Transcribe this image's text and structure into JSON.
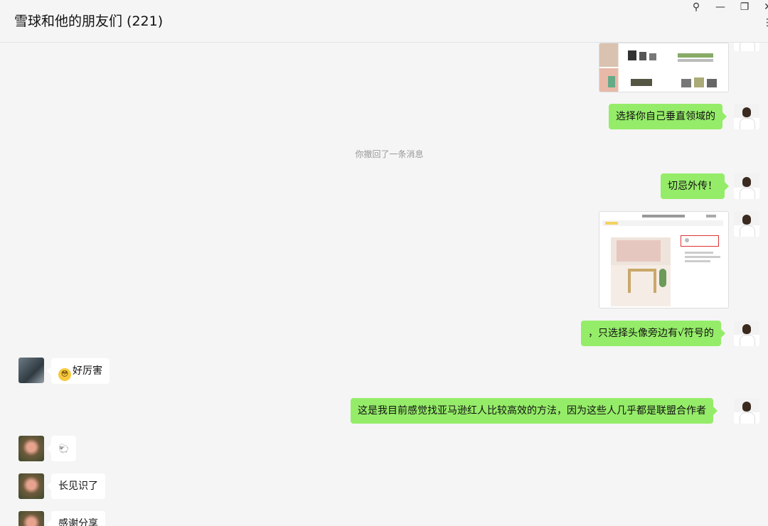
{
  "window": {
    "title": "雪球和他的朋友们 (221)",
    "controls": {
      "pin": "⚲",
      "minimize": "—",
      "restore": "❐",
      "close": "✕",
      "more": "⋮"
    }
  },
  "messages": [
    {
      "type": "image",
      "sender": "me",
      "desc_icon": "product-collage-image"
    },
    {
      "type": "text",
      "sender": "me",
      "text": "选择你自己垂直领域的"
    },
    {
      "type": "system",
      "text": "你撤回了一条消息"
    },
    {
      "type": "text",
      "sender": "me",
      "text": "切忌外传！"
    },
    {
      "type": "image",
      "sender": "me",
      "desc_icon": "webpage-screenshot-image"
    },
    {
      "type": "text",
      "sender": "me",
      "text": "，只选择头像旁边有√符号的"
    },
    {
      "type": "text",
      "sender": "other",
      "emoji": "😳",
      "text": "好厉害"
    },
    {
      "type": "text",
      "sender": "me",
      "text": "这是我目前感觉找亚马逊红人比较高效的方法，因为这些人几乎都是联盟合作者"
    },
    {
      "type": "text",
      "sender": "other",
      "text": "🐑"
    },
    {
      "type": "text",
      "sender": "other",
      "text": "长见识了"
    },
    {
      "type": "text",
      "sender": "other",
      "text": "感谢分享"
    }
  ],
  "colors": {
    "my_bubble": "#95ec69",
    "other_bubble": "#ffffff",
    "background": "#f5f5f5"
  }
}
